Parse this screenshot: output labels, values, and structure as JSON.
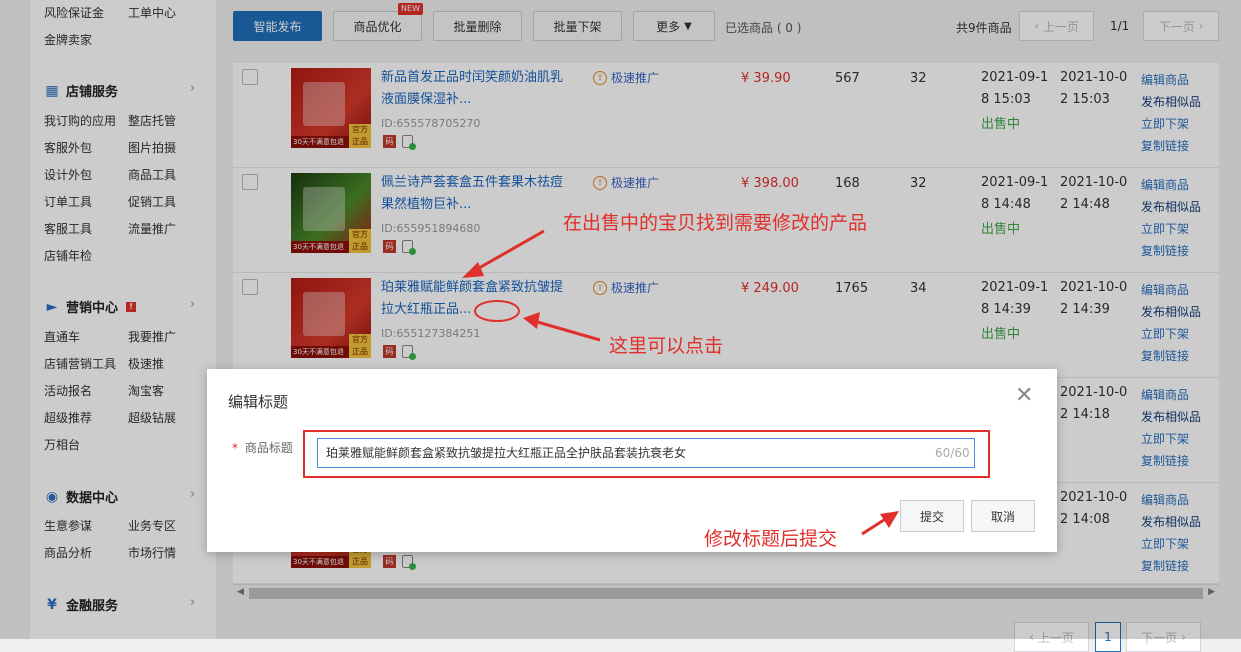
{
  "sidebar": {
    "top_items": [
      "风险保证金",
      "工单中心",
      "金牌卖家"
    ],
    "sections": [
      {
        "title": "店铺服务",
        "icon": "grid-icon",
        "items": [
          "我订购的应用",
          "整店托管",
          "客服外包",
          "图片拍摄",
          "设计外包",
          "商品工具",
          "订单工具",
          "促销工具",
          "客服工具",
          "流量推广",
          "店铺年检"
        ]
      },
      {
        "title": "营销中心",
        "icon": "megaphone-icon",
        "items": [
          "直通车",
          "我要推广",
          "店铺营销工具",
          "极速推",
          "活动报名",
          "淘宝客",
          "超级推荐",
          "超级钻展",
          "万相台"
        ]
      },
      {
        "title": "数据中心",
        "icon": "chart-circle-icon",
        "items": [
          "生意参谋",
          "业务专区",
          "商品分析",
          "市场行情"
        ]
      },
      {
        "title": "金融服务",
        "icon": "yen-circle-icon",
        "items": []
      }
    ]
  },
  "toolbar": {
    "publish": "智能发布",
    "optimize": "商品优化",
    "new_tag": "NEW",
    "batch_delete": "批量删除",
    "batch_delist": "批量下架",
    "more": "更多",
    "selected": "已选商品 ( 0 )",
    "total": "共9件商品",
    "prev": "上一页",
    "page": "1/1",
    "next": "下一页"
  },
  "rows": [
    {
      "title": "新品首发正品时闰笑颜奶油肌乳液面膜保湿补...",
      "id": "ID:655578705270",
      "promo": "极速推广",
      "price": "¥ 39.90",
      "sales": "567",
      "stock": "32",
      "created": "2021-09-18 15:03",
      "modified": "2021-10-02 15:03",
      "status": "出售中",
      "thumb_band": "30天不满意包退",
      "badge": "官方正品"
    },
    {
      "title": "佩兰诗芦荟套盒五件套果木祛痘果然植物巨补...",
      "id": "ID:655951894680",
      "promo": "极速推广",
      "price": "¥ 398.00",
      "sales": "168",
      "stock": "32",
      "created": "2021-09-18 14:48",
      "modified": "2021-10-02 14:48",
      "status": "出售中",
      "thumb_band": "30天不满意包退",
      "badge": "官方正品"
    },
    {
      "title": "珀莱雅赋能鲜颜套盒紧致抗皱提拉大红瓶正品...",
      "id": "ID:655127384251",
      "promo": "极速推广",
      "price": "¥ 249.00",
      "sales": "1765",
      "stock": "34",
      "created": "2021-09-18 14:39",
      "modified": "2021-10-02 14:39",
      "status": "出售中",
      "thumb_band": "30天不满意包退",
      "badge": "官方正品"
    },
    {
      "modified": "2021-10-02 14:18"
    },
    {
      "modified": "2021-10-02 14:08",
      "thumb_band": "30天不满意包退",
      "badge": "官方正品"
    }
  ],
  "row_actions": [
    "编辑商品",
    "发布相似品",
    "立即下架",
    "复制链接"
  ],
  "mini_badge": "码",
  "modal": {
    "title": "编辑标题",
    "required_mark": "*",
    "field_label": "商品标题",
    "title_value": "珀莱雅赋能鲜颜套盒紧致抗皱提拉大红瓶正品全护肤品套装抗衰老女",
    "counter": "60/60",
    "submit": "提交",
    "cancel": "取消"
  },
  "bottom_pager": {
    "prev": "上一页",
    "page": "1",
    "next": "下一页"
  },
  "annotations": {
    "find_product": "在出售中的宝贝找到需要修改的产品",
    "click_here": "这里可以点击",
    "submit_after": "修改标题后提交"
  },
  "colors": {
    "accent": "#1f6fba",
    "link": "#1a66c2",
    "price": "#e0302b",
    "status": "#3fa648",
    "annotation": "#e0302b"
  }
}
